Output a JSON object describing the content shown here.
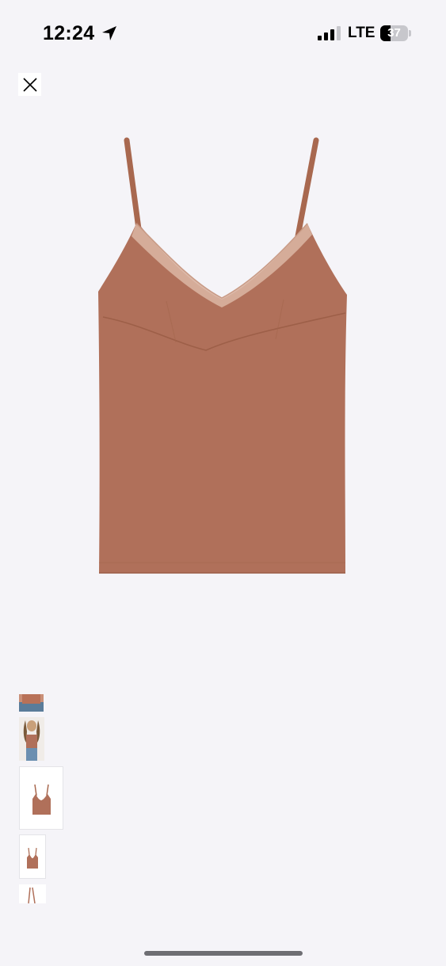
{
  "status_bar": {
    "time": "12:24",
    "network": "LTE",
    "battery_level": "37",
    "battery_fraction": 0.37
  },
  "icons": {
    "close": "close-icon",
    "location": "location-arrow-icon",
    "signal": "cellular-signal-icon",
    "battery": "battery-icon"
  },
  "colors": {
    "background": "#f5f4f8",
    "garment": "#b0705a",
    "lace": "#d9b3a0"
  },
  "gallery": {
    "thumbnail_count": 5,
    "selected_index": 2
  }
}
